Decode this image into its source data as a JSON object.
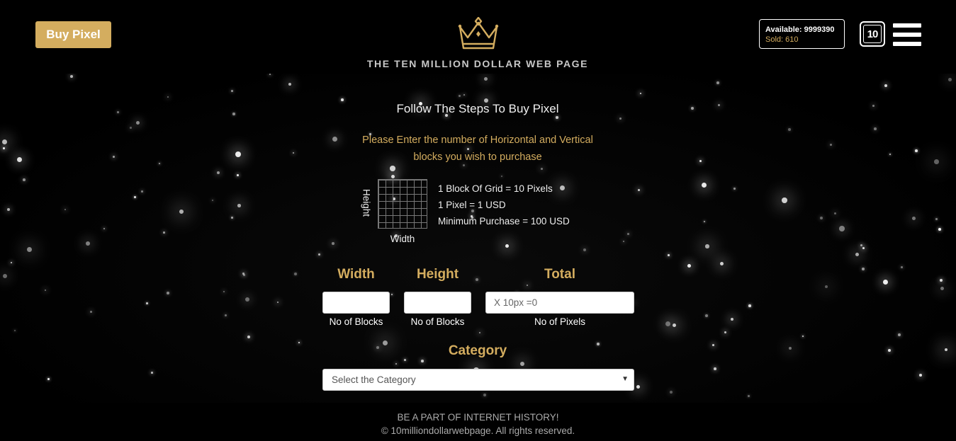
{
  "header": {
    "buy_button_label": "Buy Pixel",
    "site_title": "THE TEN MILLION DOLLAR WEB PAGE",
    "stats": {
      "available": "Available: 9999390",
      "sold": "Sold: 610"
    },
    "badge_text": "10",
    "logo_icon": "crown-icon",
    "menu_icon": "hamburger-menu-icon"
  },
  "steps": {
    "title": "Follow The Steps To Buy Pixel",
    "instruction_line1": "Please Enter the number of Horizontal and Vertical",
    "instruction_line2": "blocks you wish to purchase"
  },
  "grid_info": {
    "height_label": "Height",
    "width_label": "Width",
    "lines": [
      "1 Block Of Grid = 10 Pixels",
      "1 Pixel = 1 USD",
      "Minimum Purchase = 100 USD"
    ]
  },
  "form": {
    "width": {
      "heading": "Width",
      "value": "",
      "caption": "No of Blocks"
    },
    "height": {
      "heading": "Height",
      "value": "",
      "caption": "No of Blocks"
    },
    "total": {
      "heading": "Total",
      "value": "X 10px =0",
      "caption": "No of Pixels"
    },
    "category": {
      "heading": "Category",
      "selected": "Select the Category"
    }
  },
  "footer": {
    "line1": "BE A PART OF INTERNET HISTORY!",
    "line2": "© 10milliondollarwebpage. All rights reserved."
  },
  "colors": {
    "accent": "#d4ad5f",
    "background": "#000000",
    "text": "#ffffff"
  }
}
